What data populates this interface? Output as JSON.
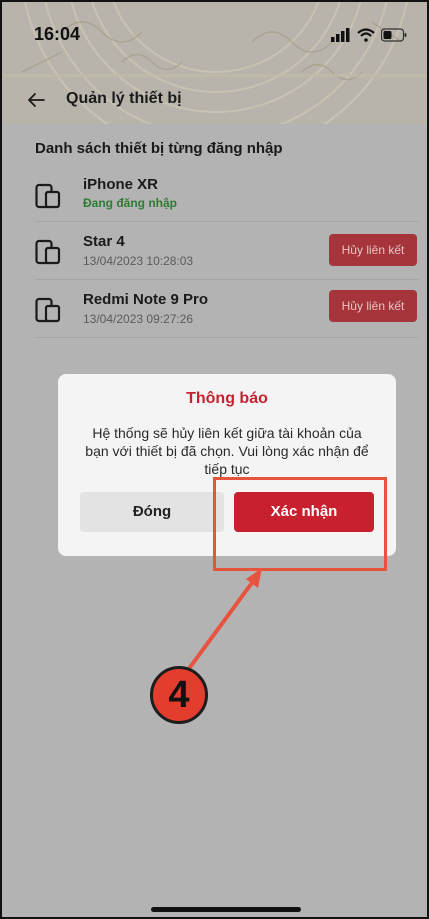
{
  "status_bar": {
    "time": "16:04",
    "icons": [
      "signal-icon",
      "wifi-icon",
      "battery-icon"
    ]
  },
  "nav": {
    "back_icon": "arrow-left-icon",
    "title": "Quản lý thiết bị"
  },
  "device_list": {
    "heading": "Danh sách thiết bị từng đăng nhập",
    "devices": [
      {
        "name": "iPhone XR",
        "status": "Đang đăng nhập",
        "active": true,
        "action": ""
      },
      {
        "name": "Star 4",
        "status": "13/04/2023 10:28:03",
        "active": false,
        "action": "Hủy liên kết"
      },
      {
        "name": "Redmi Note 9 Pro",
        "status": "13/04/2023 09:27:26",
        "active": false,
        "action": "Hủy liên kết"
      }
    ]
  },
  "dialog": {
    "title": "Thông báo",
    "message": "Hệ thống sẽ hủy liên kết giữa tài khoản của bạn với thiết bị đã chọn. Vui lòng xác nhận để tiếp tục",
    "close_label": "Đóng",
    "confirm_label": "Xác nhận"
  },
  "annotation": {
    "step_number": "4"
  },
  "colors": {
    "accent_red": "#c9202f",
    "active_green": "#2f7a33",
    "annotation_red": "#e6533f"
  }
}
